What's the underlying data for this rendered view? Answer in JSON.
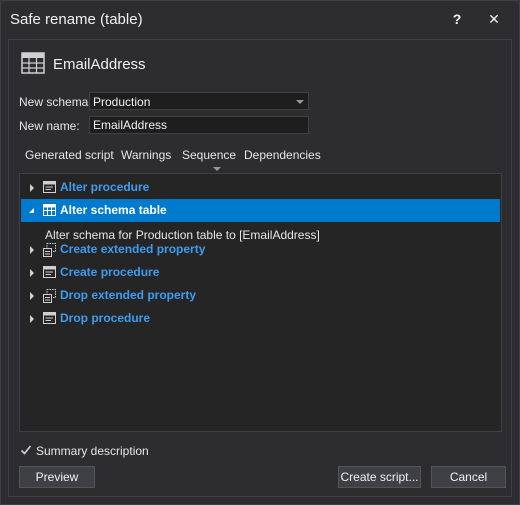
{
  "window": {
    "title": "Safe rename (table)",
    "help_glyph": "?",
    "close_glyph": "✕"
  },
  "header": {
    "object_name": "EmailAddress",
    "icon": "table-icon"
  },
  "form": {
    "schema_label": "New schema:",
    "schema_value": "Production",
    "name_label": "New name:",
    "name_value": "EmailAddress"
  },
  "tabs": [
    {
      "label": "Generated script"
    },
    {
      "label": "Warnings"
    },
    {
      "label": "Sequence",
      "active": true
    },
    {
      "label": "Dependencies"
    }
  ],
  "tree": {
    "items": [
      {
        "label": "Alter procedure",
        "icon": "procedure-icon",
        "expanded": false,
        "selected": false
      },
      {
        "label": "Alter schema table",
        "icon": "table-icon",
        "expanded": true,
        "selected": true,
        "detail": "Alter schema for Production table to [EmailAddress]"
      },
      {
        "label": "Create extended property",
        "icon": "extended-property-icon",
        "expanded": false,
        "selected": false
      },
      {
        "label": "Create procedure",
        "icon": "procedure-icon",
        "expanded": false,
        "selected": false
      },
      {
        "label": "Drop extended property",
        "icon": "extended-property-icon",
        "expanded": false,
        "selected": false
      },
      {
        "label": "Drop procedure",
        "icon": "procedure-icon",
        "expanded": false,
        "selected": false
      }
    ]
  },
  "footer": {
    "summary_label": "Summary description",
    "summary_checked": true,
    "preview_label": "Preview",
    "create_script_label": "Create script...",
    "cancel_label": "Cancel"
  },
  "colors": {
    "background": "#2d2d30",
    "selection": "#007acc",
    "link_text": "#3e9cf0"
  }
}
